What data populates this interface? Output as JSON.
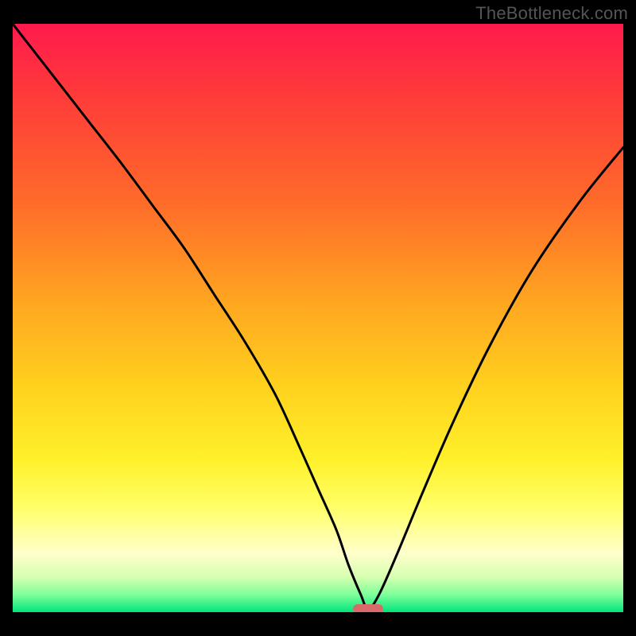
{
  "watermark": "TheBottleneck.com",
  "chart_data": {
    "type": "line",
    "title": "",
    "xlabel": "",
    "ylabel": "",
    "xlim": [
      0,
      100
    ],
    "ylim": [
      0,
      100
    ],
    "grid": false,
    "legend": false,
    "series": [
      {
        "name": "bottleneck-curve",
        "x": [
          0,
          6,
          12,
          18,
          23,
          28,
          33,
          38,
          43,
          47,
          50,
          53,
          55,
          57,
          58.2,
          60,
          63,
          67,
          72,
          78,
          85,
          93,
          100
        ],
        "values": [
          100,
          92,
          84,
          76,
          69,
          62,
          54,
          46,
          37,
          28,
          21,
          14,
          8,
          3,
          0.5,
          3,
          10,
          20,
          32,
          45,
          58,
          70,
          79
        ]
      }
    ],
    "annotations": [
      {
        "name": "optimal-marker",
        "shape": "pill",
        "x": 58.2,
        "y": 0.5,
        "color": "#d86a6a"
      }
    ],
    "background_gradient": {
      "direction": "vertical",
      "stops": [
        {
          "pos": 0,
          "color": "#ff1a4d"
        },
        {
          "pos": 12,
          "color": "#ff3a3a"
        },
        {
          "pos": 30,
          "color": "#ff6a2a"
        },
        {
          "pos": 48,
          "color": "#ffa820"
        },
        {
          "pos": 62,
          "color": "#ffd21e"
        },
        {
          "pos": 74,
          "color": "#fff02a"
        },
        {
          "pos": 82,
          "color": "#ffff66"
        },
        {
          "pos": 90,
          "color": "#ffffcc"
        },
        {
          "pos": 94,
          "color": "#d7ffb0"
        },
        {
          "pos": 97,
          "color": "#7fff9a"
        },
        {
          "pos": 100,
          "color": "#00e67a"
        }
      ]
    }
  }
}
